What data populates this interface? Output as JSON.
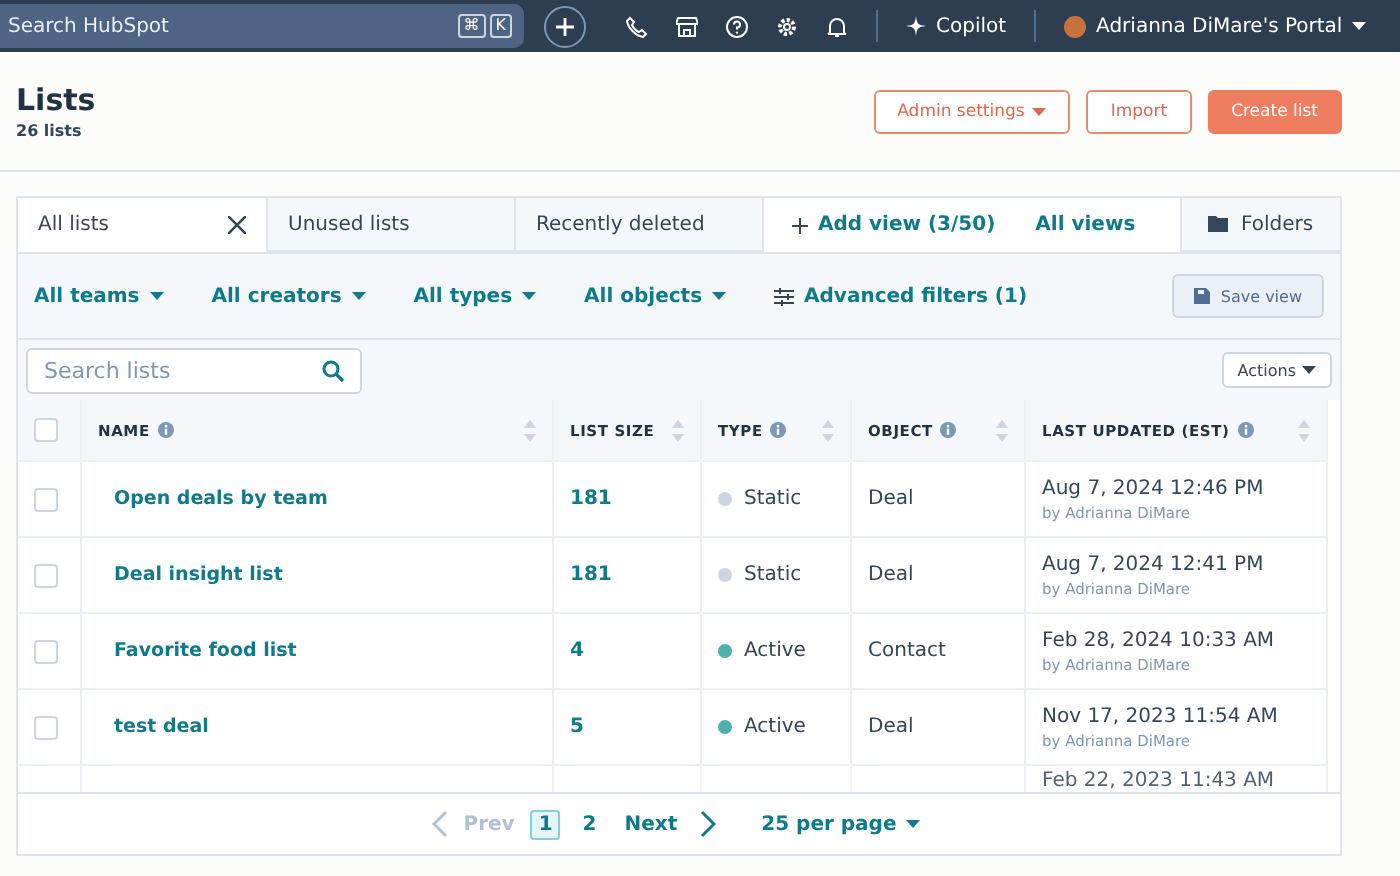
{
  "top_nav": {
    "search": {
      "placeholder": "Search HubSpot",
      "shortcut": [
        "⌘",
        "K"
      ]
    },
    "copilot": "Copilot",
    "portal": "Adrianna DiMare's Portal"
  },
  "header": {
    "title": "Lists",
    "count": "26 lists",
    "buttons": [
      {
        "label": "Admin settings",
        "kind": "menu"
      },
      {
        "label": "Import",
        "kind": "secondary"
      },
      {
        "label": "Create list",
        "kind": "primary"
      }
    ]
  },
  "tabs": [
    {
      "label": "All lists",
      "selected": true,
      "closable": true
    },
    {
      "label": "Unused lists",
      "selected": false,
      "closable": false
    },
    {
      "label": "Recently deleted",
      "selected": false,
      "closable": false
    }
  ],
  "add_view": "Add view (3/50)",
  "all_views": "All views",
  "folders": "Folders",
  "filters": [
    {
      "label": "All teams",
      "kind": "dropdown"
    },
    {
      "label": "All creators",
      "kind": "dropdown"
    },
    {
      "label": "All types",
      "kind": "dropdown"
    },
    {
      "label": "All objects",
      "kind": "dropdown"
    },
    {
      "label": "Advanced filters (1)",
      "kind": "advanced"
    }
  ],
  "save_view": "Save view",
  "search": {
    "placeholder": "Search lists"
  },
  "actions": "Actions",
  "table": {
    "select_all": {
      "checked": false
    },
    "columns": [
      {
        "label": "NAME",
        "info": true
      },
      {
        "label": "LIST SIZE",
        "info": false
      },
      {
        "label": "TYPE",
        "info": true
      },
      {
        "label": "OBJECT",
        "info": true
      },
      {
        "label": "LAST UPDATED (EST)",
        "info": true
      }
    ],
    "rows": [
      {
        "name": "Open deals by team",
        "size": "181",
        "type": "Static",
        "color": "#cbd6e2",
        "object": "Deal",
        "updated": "Aug 7, 2024 12:46 PM",
        "by": "by Adrianna DiMare",
        "checked": false
      },
      {
        "name": "Deal insight list",
        "size": "181",
        "type": "Static",
        "color": "#cbd6e2",
        "object": "Deal",
        "updated": "Aug 7, 2024 12:41 PM",
        "by": "by Adrianna DiMare",
        "checked": false
      },
      {
        "name": "Favorite food list",
        "size": "4",
        "type": "Active",
        "color": "#4fb0ae",
        "object": "Contact",
        "updated": "Feb 28, 2024 10:33 AM",
        "by": "by Adrianna DiMare",
        "checked": false
      },
      {
        "name": "test deal",
        "size": "5",
        "type": "Active",
        "color": "#4fb0ae",
        "object": "Deal",
        "updated": "Nov 17, 2023 11:54 AM",
        "by": "by Adrianna DiMare",
        "checked": false
      }
    ],
    "partial_row": {
      "updated": "Feb 22, 2023 11:43 AM"
    }
  },
  "pagination": {
    "prev": "Prev",
    "pages": [
      {
        "label": "1",
        "selected": true
      },
      {
        "label": "2",
        "selected": false
      }
    ],
    "next": "Next",
    "per_page": "25 per page"
  }
}
